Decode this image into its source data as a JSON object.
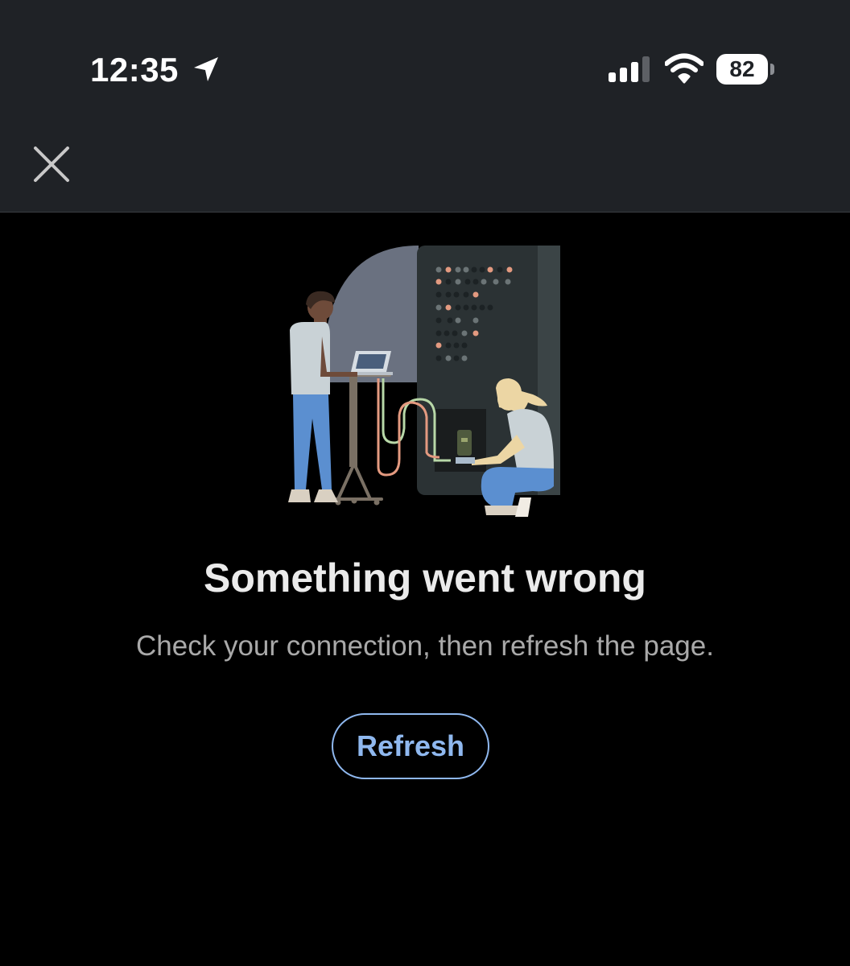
{
  "status_bar": {
    "time": "12:35",
    "battery_level": "82",
    "icons": [
      "location-arrow-icon",
      "cellular-signal-icon",
      "wifi-icon",
      "battery-icon"
    ]
  },
  "header": {
    "close_icon": "close-icon"
  },
  "illustration": {
    "icon": "server-maintenance-illustration"
  },
  "error": {
    "title": "Something went wrong",
    "message": "Check your connection, then refresh the page."
  },
  "actions": {
    "refresh_label": "Refresh"
  },
  "colors": {
    "chrome_background": "#1f2226",
    "page_background": "#000000",
    "title_text": "#ebebeb",
    "message_text": "#a9a9a9",
    "accent": "#8fb8ef"
  }
}
